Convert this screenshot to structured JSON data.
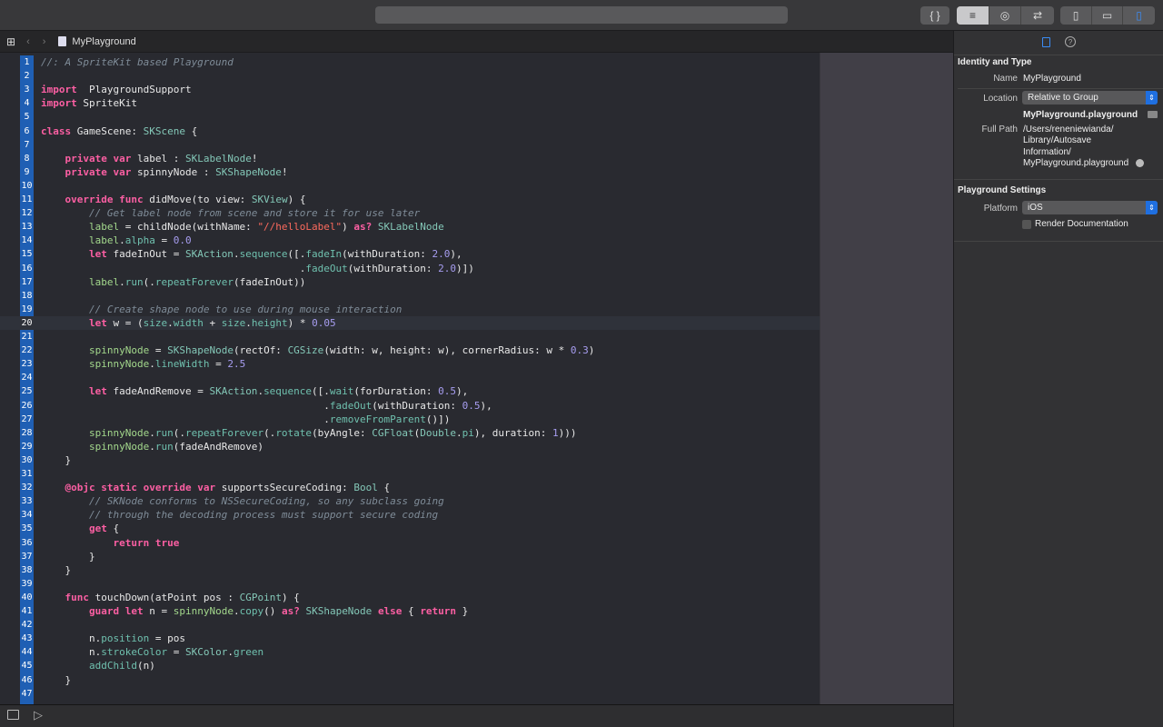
{
  "toolbar": {
    "buttons": [
      "{ }"
    ],
    "editor_modes": [
      "≡",
      "◎",
      "⇄"
    ],
    "panels": [
      "▯",
      "▭",
      "▯"
    ]
  },
  "jump_bar": {
    "file": "MyPlayground"
  },
  "editor": {
    "current_line": 20,
    "lines": [
      [
        [
          "c",
          "//: A SpriteKit based Playground"
        ]
      ],
      [],
      [
        [
          "k",
          "import"
        ],
        [
          "",
          "  PlaygroundSupport"
        ]
      ],
      [
        [
          "k",
          "import"
        ],
        [
          "",
          " SpriteKit"
        ]
      ],
      [],
      [
        [
          "k",
          "class"
        ],
        [
          "",
          " GameScene: "
        ],
        [
          "t",
          "SKScene"
        ],
        [
          "",
          " {"
        ]
      ],
      [],
      [
        [
          "",
          "    "
        ],
        [
          "k",
          "private"
        ],
        [
          "",
          " "
        ],
        [
          "k",
          "var"
        ],
        [
          "",
          " label : "
        ],
        [
          "t",
          "SKLabelNode"
        ],
        [
          "",
          "!"
        ]
      ],
      [
        [
          "",
          "    "
        ],
        [
          "k",
          "private"
        ],
        [
          "",
          " "
        ],
        [
          "k",
          "var"
        ],
        [
          "",
          " spinnyNode : "
        ],
        [
          "t",
          "SKShapeNode"
        ],
        [
          "",
          "!"
        ]
      ],
      [],
      [
        [
          "",
          "    "
        ],
        [
          "k",
          "override"
        ],
        [
          "",
          " "
        ],
        [
          "k",
          "func"
        ],
        [
          "",
          " didMove(to view: "
        ],
        [
          "t",
          "SKView"
        ],
        [
          "",
          ") {"
        ]
      ],
      [
        [
          "",
          "        "
        ],
        [
          "c",
          "// Get label node from scene and store it for use later"
        ]
      ],
      [
        [
          "",
          "        "
        ],
        [
          "p",
          "label"
        ],
        [
          "",
          " = childNode(withName: "
        ],
        [
          "s",
          "\"//helloLabel\""
        ],
        [
          "",
          ") "
        ],
        [
          "k",
          "as?"
        ],
        [
          "",
          " "
        ],
        [
          "t",
          "SKLabelNode"
        ]
      ],
      [
        [
          "",
          "        "
        ],
        [
          "p",
          "label"
        ],
        [
          "",
          "."
        ],
        [
          "m",
          "alpha"
        ],
        [
          "",
          " = "
        ],
        [
          "n",
          "0.0"
        ]
      ],
      [
        [
          "",
          "        "
        ],
        [
          "k",
          "let"
        ],
        [
          "",
          " fadeInOut = "
        ],
        [
          "t",
          "SKAction"
        ],
        [
          "",
          "."
        ],
        [
          "m",
          "sequence"
        ],
        [
          "",
          "([."
        ],
        [
          "m",
          "fadeIn"
        ],
        [
          "",
          "(withDuration: "
        ],
        [
          "n",
          "2.0"
        ],
        [
          "",
          "),"
        ]
      ],
      [
        [
          "",
          "                                           ."
        ],
        [
          "m",
          "fadeOut"
        ],
        [
          "",
          "(withDuration: "
        ],
        [
          "n",
          "2.0"
        ],
        [
          "",
          ")])"
        ]
      ],
      [
        [
          "",
          "        "
        ],
        [
          "p",
          "label"
        ],
        [
          "",
          "."
        ],
        [
          "m",
          "run"
        ],
        [
          "",
          "(."
        ],
        [
          "m",
          "repeatForever"
        ],
        [
          "",
          "(fadeInOut))"
        ]
      ],
      [],
      [
        [
          "",
          "        "
        ],
        [
          "c",
          "// Create shape node to use during mouse interaction"
        ]
      ],
      [
        [
          "",
          "        "
        ],
        [
          "k",
          "let"
        ],
        [
          "",
          " w = ("
        ],
        [
          "m",
          "size"
        ],
        [
          "",
          "."
        ],
        [
          "m",
          "width"
        ],
        [
          "",
          " + "
        ],
        [
          "m",
          "size"
        ],
        [
          "",
          "."
        ],
        [
          "m",
          "height"
        ],
        [
          "",
          ") * "
        ],
        [
          "n",
          "0.05"
        ]
      ],
      [],
      [
        [
          "",
          "        "
        ],
        [
          "p",
          "spinnyNode"
        ],
        [
          "",
          " = "
        ],
        [
          "t",
          "SKShapeNode"
        ],
        [
          "",
          "(rectOf: "
        ],
        [
          "t",
          "CGSize"
        ],
        [
          "",
          "(width: w, height: w), cornerRadius: w * "
        ],
        [
          "n",
          "0.3"
        ],
        [
          "",
          ")"
        ]
      ],
      [
        [
          "",
          "        "
        ],
        [
          "p",
          "spinnyNode"
        ],
        [
          "",
          "."
        ],
        [
          "m",
          "lineWidth"
        ],
        [
          "",
          " = "
        ],
        [
          "n",
          "2.5"
        ]
      ],
      [],
      [
        [
          "",
          "        "
        ],
        [
          "k",
          "let"
        ],
        [
          "",
          " fadeAndRemove = "
        ],
        [
          "t",
          "SKAction"
        ],
        [
          "",
          "."
        ],
        [
          "m",
          "sequence"
        ],
        [
          "",
          "([."
        ],
        [
          "m",
          "wait"
        ],
        [
          "",
          "(forDuration: "
        ],
        [
          "n",
          "0.5"
        ],
        [
          "",
          "),"
        ]
      ],
      [
        [
          "",
          "                                               ."
        ],
        [
          "m",
          "fadeOut"
        ],
        [
          "",
          "(withDuration: "
        ],
        [
          "n",
          "0.5"
        ],
        [
          "",
          "),"
        ]
      ],
      [
        [
          "",
          "                                               ."
        ],
        [
          "m",
          "removeFromParent"
        ],
        [
          "",
          "()])"
        ]
      ],
      [
        [
          "",
          "        "
        ],
        [
          "p",
          "spinnyNode"
        ],
        [
          "",
          "."
        ],
        [
          "m",
          "run"
        ],
        [
          "",
          "(."
        ],
        [
          "m",
          "repeatForever"
        ],
        [
          "",
          "(."
        ],
        [
          "m",
          "rotate"
        ],
        [
          "",
          "(byAngle: "
        ],
        [
          "t",
          "CGFloat"
        ],
        [
          "",
          "("
        ],
        [
          "t",
          "Double"
        ],
        [
          "",
          "."
        ],
        [
          "m",
          "pi"
        ],
        [
          "",
          "), duration: "
        ],
        [
          "n",
          "1"
        ],
        [
          "",
          ")))"
        ]
      ],
      [
        [
          "",
          "        "
        ],
        [
          "p",
          "spinnyNode"
        ],
        [
          "",
          "."
        ],
        [
          "m",
          "run"
        ],
        [
          "",
          "(fadeAndRemove)"
        ]
      ],
      [
        [
          "",
          "    }"
        ]
      ],
      [],
      [
        [
          "",
          "    "
        ],
        [
          "k",
          "@objc static override var"
        ],
        [
          "",
          " supportsSecureCoding: "
        ],
        [
          "t",
          "Bool"
        ],
        [
          "",
          " {"
        ]
      ],
      [
        [
          "",
          "        "
        ],
        [
          "c",
          "// SKNode conforms to NSSecureCoding, so any subclass going"
        ]
      ],
      [
        [
          "",
          "        "
        ],
        [
          "c",
          "// through the decoding process must support secure coding"
        ]
      ],
      [
        [
          "",
          "        "
        ],
        [
          "k",
          "get"
        ],
        [
          "",
          " {"
        ]
      ],
      [
        [
          "",
          "            "
        ],
        [
          "k",
          "return true"
        ]
      ],
      [
        [
          "",
          "        }"
        ]
      ],
      [
        [
          "",
          "    }"
        ]
      ],
      [],
      [
        [
          "",
          "    "
        ],
        [
          "k",
          "func"
        ],
        [
          "",
          " touchDown(atPoint pos : "
        ],
        [
          "t",
          "CGPoint"
        ],
        [
          "",
          ") {"
        ]
      ],
      [
        [
          "",
          "        "
        ],
        [
          "k",
          "guard let"
        ],
        [
          "",
          " n = "
        ],
        [
          "p",
          "spinnyNode"
        ],
        [
          "",
          "."
        ],
        [
          "m",
          "copy"
        ],
        [
          "",
          "() "
        ],
        [
          "k",
          "as?"
        ],
        [
          "",
          " "
        ],
        [
          "t",
          "SKShapeNode"
        ],
        [
          "",
          " "
        ],
        [
          "k",
          "else"
        ],
        [
          "",
          " { "
        ],
        [
          "k",
          "return"
        ],
        [
          "",
          " }"
        ]
      ],
      [],
      [
        [
          "",
          "        n."
        ],
        [
          "m",
          "position"
        ],
        [
          "",
          " = pos"
        ]
      ],
      [
        [
          "",
          "        n."
        ],
        [
          "m",
          "strokeColor"
        ],
        [
          "",
          " = "
        ],
        [
          "t",
          "SKColor"
        ],
        [
          "",
          "."
        ],
        [
          "m",
          "green"
        ]
      ],
      [
        [
          "",
          "        "
        ],
        [
          "m",
          "addChild"
        ],
        [
          "",
          "(n)"
        ]
      ],
      [
        [
          "",
          "    }"
        ]
      ],
      []
    ]
  },
  "inspector": {
    "identity_title": "Identity and Type",
    "name_label": "Name",
    "name_value": "MyPlayground",
    "location_label": "Location",
    "location_value": "Relative to Group",
    "file_name": "MyPlayground.playground",
    "full_path_label": "Full Path",
    "full_path_lines": [
      "/Users/reneniewianda/",
      "Library/Autosave",
      "Information/",
      "MyPlayground.playground"
    ],
    "settings_title": "Playground Settings",
    "platform_label": "Platform",
    "platform_value": "iOS",
    "render_docs_label": "Render Documentation",
    "render_docs_checked": false
  },
  "colors": {
    "accent": "#1f6fe0",
    "gutter": "#1f5fb4",
    "keyword": "#fc5fa3",
    "string": "#fc6a5d",
    "number": "#a79df0",
    "comment": "#7f8c98"
  }
}
